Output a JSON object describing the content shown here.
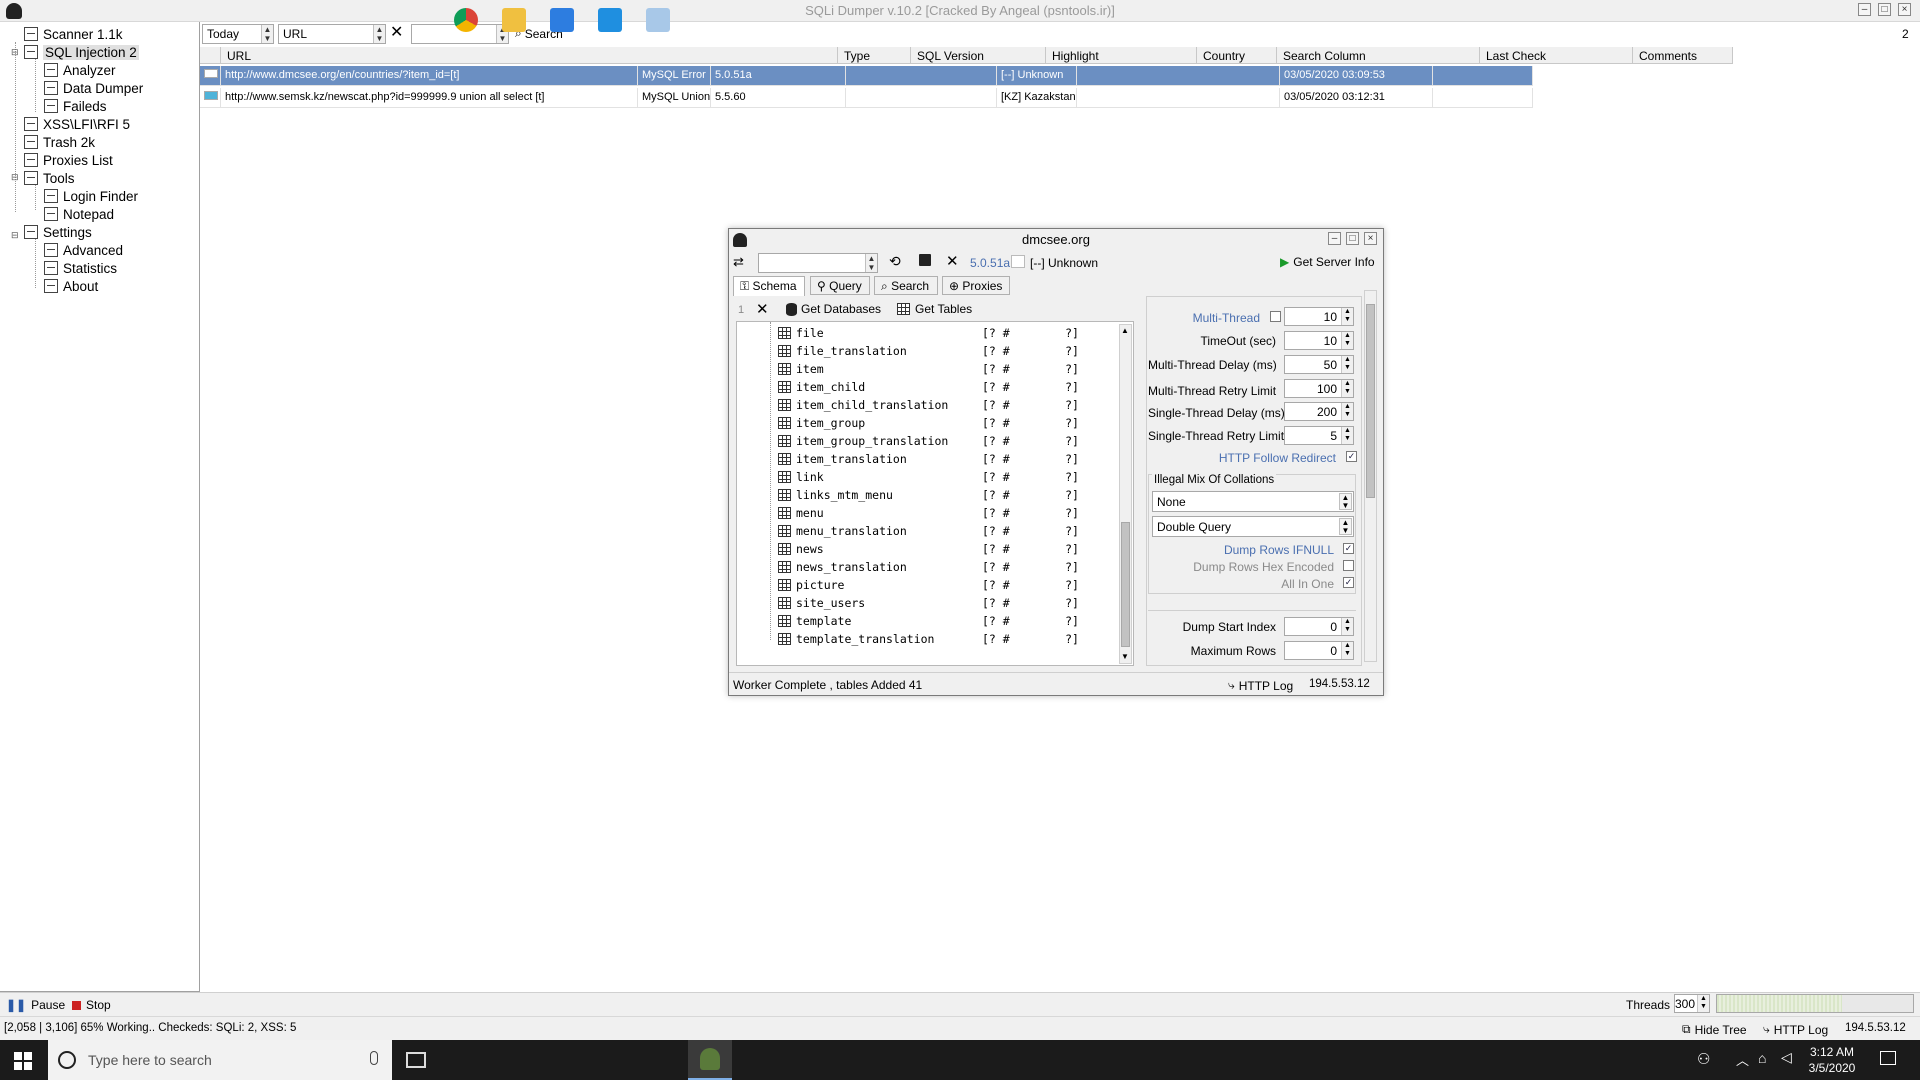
{
  "window": {
    "title": "SQLi Dumper v.10.2 [Cracked By Angeal (psntools.ir)]"
  },
  "tree": {
    "items": [
      {
        "label": "Scanner  1.1k"
      },
      {
        "label": "SQL Injection  2"
      },
      {
        "label": "Analyzer"
      },
      {
        "label": "Data Dumper"
      },
      {
        "label": "Faileds"
      },
      {
        "label": "XSS\\LFI\\RFI  5"
      },
      {
        "label": "Trash  2k"
      },
      {
        "label": "Proxies List"
      },
      {
        "label": "Tools"
      },
      {
        "label": "Login Finder"
      },
      {
        "label": "Notepad"
      },
      {
        "label": "Settings"
      },
      {
        "label": "Advanced"
      },
      {
        "label": "Statistics"
      },
      {
        "label": "About"
      }
    ]
  },
  "filterbar": {
    "date": "Today",
    "field": "URL",
    "query": "",
    "search_label": "Search",
    "page": "2"
  },
  "grid": {
    "columns": [
      "URL",
      "Type",
      "SQL Version",
      "Highlight",
      "Country",
      "Search Column",
      "Last Check",
      "Comments"
    ],
    "rows": [
      [
        "http://www.dmcsee.org/en/countries/?item_id=[t]",
        "MySQL Error",
        "5.0.51a",
        "",
        "[--] Unknown",
        "",
        "03/05/2020 03:09:53",
        ""
      ],
      [
        "http://www.semsk.kz/newscat.php?id=999999.9 union all select [t]",
        "MySQL Union",
        "5.5.60",
        "",
        "[KZ] Kazakstan",
        "",
        "03/05/2020 03:12:31",
        ""
      ]
    ]
  },
  "dialog": {
    "title": "dmcsee.org",
    "version": "5.0.51a",
    "country": "[--] Unknown",
    "server_info_label": "Get Server Info",
    "tabs": [
      "Schema",
      "Query",
      "Search",
      "Proxies"
    ],
    "schema_toolbar": {
      "index": "1",
      "get_databases": "Get Databases",
      "get_tables": "Get Tables"
    },
    "tables": [
      "file",
      "file_translation",
      "item",
      "item_child",
      "item_child_translation",
      "item_group",
      "item_group_translation",
      "item_translation",
      "link",
      "links_mtm_menu",
      "menu",
      "menu_translation",
      "news",
      "news_translation",
      "picture",
      "site_users",
      "template",
      "template_translation"
    ],
    "table_meta": {
      "open": "[?",
      "hash": "#",
      "close": "?]"
    },
    "settings": {
      "multi_thread": {
        "label": "Multi-Thread",
        "value": "10"
      },
      "timeout": {
        "label": "TimeOut (sec)",
        "value": "10"
      },
      "mt_delay": {
        "label": "Multi-Thread Delay  (ms)",
        "value": "50"
      },
      "mt_retry": {
        "label": "Multi-Thread Retry Limit",
        "value": "100"
      },
      "st_delay": {
        "label": "Single-Thread Delay  (ms)",
        "value": "200"
      },
      "st_retry": {
        "label": "Single-Thread Retry Limit",
        "value": "5"
      },
      "follow_redirect": "HTTP Follow Redirect",
      "collations_group": "Illegal Mix Of Collations",
      "collation_value": "None",
      "query_mode": "Double Query",
      "dump_ifnull": "Dump Rows IFNULL",
      "dump_hex": "Dump Rows Hex Encoded",
      "all_in_one": "All In One",
      "dump_start": {
        "label": "Dump Start Index",
        "value": "0"
      },
      "max_rows": {
        "label": "Maximum Rows",
        "value": "0"
      }
    },
    "status": "Worker Complete , tables Added  41",
    "http_log": "HTTP Log",
    "ip": "194.5.53.12"
  },
  "controls": {
    "pause": "Pause",
    "stop": "Stop",
    "threads_label": "Threads",
    "threads_value": "300"
  },
  "statusbar": {
    "text": "[2,058 | 3,106] 65% Working.. Checkeds:  SQLi: 2, XSS: 5",
    "hide_tree": "Hide Tree",
    "http_log": "HTTP Log",
    "ip": "194.5.53.12"
  },
  "taskbar": {
    "search_placeholder": "Type here to search",
    "time": "3:12 AM",
    "date": "3/5/2020"
  },
  "colors": {
    "selection": "#6b8fc2",
    "accent_blue": "#4a6fb0",
    "taskbar": "#1b1b1b"
  }
}
